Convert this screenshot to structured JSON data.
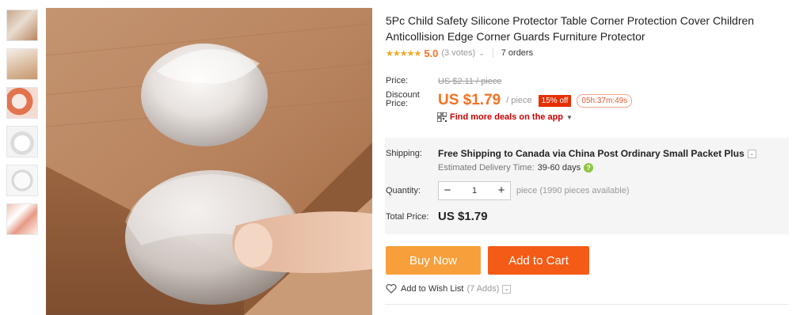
{
  "thumbnails": [
    {
      "name": "thumb-1"
    },
    {
      "name": "thumb-2"
    },
    {
      "name": "thumb-3"
    },
    {
      "name": "thumb-4"
    },
    {
      "name": "thumb-5"
    },
    {
      "name": "thumb-6"
    }
  ],
  "product": {
    "title": "5Pc Child Safety Silicone Protector Table Corner Protection Cover Children Anticollision Edge Corner Guards Furniture Protector",
    "stars": "★★★★★",
    "rating": "5.0",
    "votes": "(3 votes)",
    "orders": "7 orders"
  },
  "pricing": {
    "price_label": "Price:",
    "old_price": "US $2.11 / piece",
    "discount_label": "Discount\nPrice:",
    "price": "US $1.79",
    "per": "/ piece",
    "discount_badge": "15% off",
    "timer": "05h:37m:49s",
    "app_deals": "Find more deals on the app"
  },
  "shipping": {
    "label": "Shipping:",
    "text": "Free Shipping to Canada via China Post Ordinary Small Packet Plus",
    "est_label": "Estimated Delivery Time:",
    "est_days": "39-60 days"
  },
  "quantity": {
    "label": "Quantity:",
    "minus": "−",
    "value": "1",
    "plus": "+",
    "available": "piece (1990 pieces available)"
  },
  "total": {
    "label": "Total Price:",
    "value": "US $1.79"
  },
  "actions": {
    "buy_now": "Buy Now",
    "add_to_cart": "Add to Cart",
    "wish_label": "Add to Wish List",
    "wish_count": "(7 Adds)"
  },
  "colors": {
    "accent": "#f57224",
    "buy": "#f7a03b",
    "cart": "#f45b16",
    "badge": "#e62e04"
  }
}
